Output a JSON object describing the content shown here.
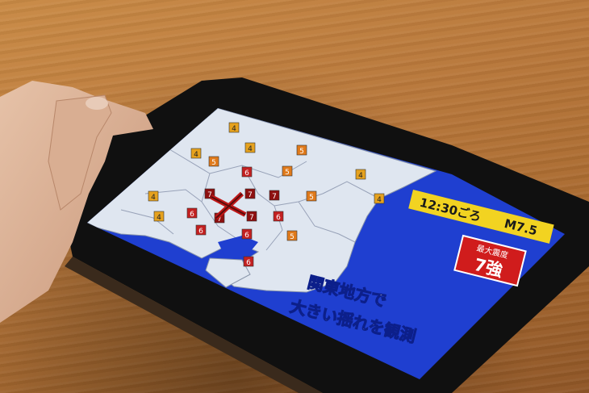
{
  "screen": {
    "time_label": "12:30ごろ",
    "magnitude_label": "M7.5",
    "max_intensity_label": "最大震度",
    "max_intensity_value": "7強",
    "headline_line1": "関東地方で",
    "headline_line2": "大きい揺れを観測"
  },
  "intensity_markers": [
    {
      "value": "4",
      "level": "moderate"
    },
    {
      "value": "4",
      "level": "moderate"
    },
    {
      "value": "4",
      "level": "moderate"
    },
    {
      "value": "5",
      "level": "strong"
    },
    {
      "value": "5",
      "level": "strong"
    },
    {
      "value": "4",
      "level": "moderate"
    },
    {
      "value": "5",
      "level": "strong"
    },
    {
      "value": "6",
      "level": "severe"
    },
    {
      "value": "7",
      "level": "max"
    },
    {
      "value": "7",
      "level": "max"
    },
    {
      "value": "7",
      "level": "max"
    },
    {
      "value": "7",
      "level": "max"
    },
    {
      "value": "7",
      "level": "max"
    },
    {
      "value": "6",
      "level": "severe"
    },
    {
      "value": "6",
      "level": "severe"
    },
    {
      "value": "6",
      "level": "severe"
    },
    {
      "value": "5",
      "level": "strong"
    },
    {
      "value": "4",
      "level": "moderate"
    },
    {
      "value": "4",
      "level": "moderate"
    },
    {
      "value": "5",
      "level": "strong"
    },
    {
      "value": "4",
      "level": "moderate"
    },
    {
      "value": "6",
      "level": "severe"
    },
    {
      "value": "6",
      "level": "severe"
    }
  ],
  "colors": {
    "sea": "#1f3fd0",
    "land": "#dfe6f0",
    "banner_yellow": "#f2d321",
    "intensity_red": "#d01c1c",
    "marker_moderate": "#e6a21e",
    "marker_strong": "#e07a1b",
    "marker_severe": "#c32020",
    "marker_max": "#8e1010",
    "epicenter": "#c01818"
  }
}
